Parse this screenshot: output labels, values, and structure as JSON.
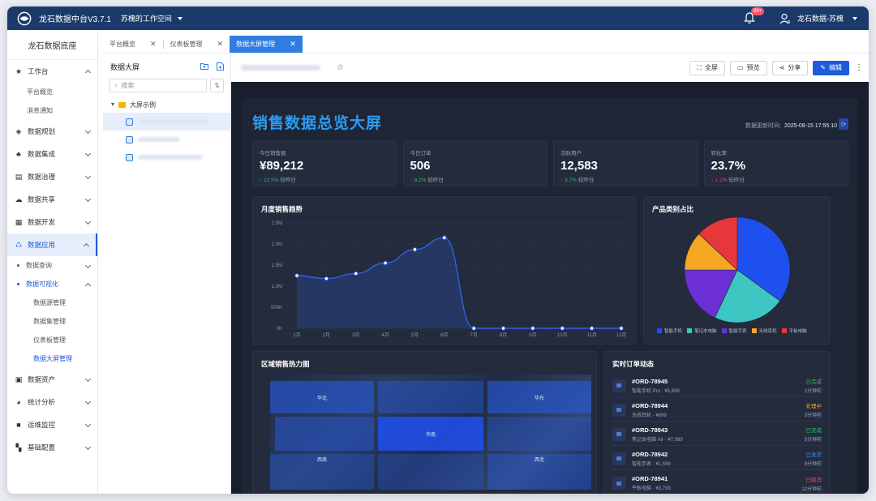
{
  "app": {
    "title": "龙石数据中台V3.7.1",
    "workspace": "苏槐的工作空间",
    "notif_count": "99+",
    "user": "龙石数据-苏槐"
  },
  "sidebar": {
    "brand": "龙石数据底座",
    "items": [
      {
        "label": "工作台",
        "icon": "star-icon",
        "open": true,
        "subs": [
          "平台概览",
          "消息通知"
        ]
      },
      {
        "label": "数据规划",
        "icon": "layers-icon"
      },
      {
        "label": "数据集成",
        "icon": "integration-icon"
      },
      {
        "label": "数据治理",
        "icon": "governance-icon"
      },
      {
        "label": "数据共享",
        "icon": "cloud-icon"
      },
      {
        "label": "数据开发",
        "icon": "dev-icon"
      },
      {
        "label": "数据应用",
        "icon": "app-icon",
        "active": true
      },
      {
        "label": "数据查询"
      },
      {
        "label": "数据可视化",
        "subs": [
          "数据源管理",
          "数据集管理",
          "仪表板管理",
          "数据大屏管理"
        ]
      },
      {
        "label": "数据资产",
        "icon": "asset-icon"
      },
      {
        "label": "统计分析",
        "icon": "pie-icon"
      },
      {
        "label": "运维监控",
        "icon": "video-icon"
      },
      {
        "label": "基础配置",
        "icon": "grid-icon"
      }
    ]
  },
  "tabs": [
    {
      "label": "平台概览"
    },
    {
      "label": "仪表板管理"
    },
    {
      "label": "数据大屏管理"
    }
  ],
  "tree": {
    "title": "数据大屏",
    "search_placeholder": "搜索",
    "folder": "大屏示例"
  },
  "toolbar": {
    "fullscreen": "全屏",
    "preview": "预览",
    "share": "分享",
    "edit": "编辑"
  },
  "dashboard": {
    "title": "销售数据总览大屏",
    "update_label": "数据更新时间:",
    "update_time": "2025-08-15 17:55:10",
    "kpis": [
      {
        "label": "今日销售额",
        "value": "¥89,212",
        "change": "12.5%",
        "dir": "up",
        "suffix": "较昨日"
      },
      {
        "label": "今日订单",
        "value": "506",
        "change": "8.2%",
        "dir": "up",
        "suffix": "较昨日"
      },
      {
        "label": "活跃用户",
        "value": "12,583",
        "change": "5.7%",
        "dir": "up",
        "suffix": "较昨日"
      },
      {
        "label": "转化率",
        "value": "23.7%",
        "change": "1.2%",
        "dir": "down",
        "suffix": "较昨日"
      }
    ],
    "trend_title": "月度销售趋势",
    "pie_title": "产品类别占比",
    "heat_title": "区域销售热力图",
    "orders_title": "实时订单动态",
    "heat_regions": [
      "华北",
      "华东",
      "华南",
      "西南",
      "西北"
    ],
    "orders": [
      {
        "id": "#ORD-78945",
        "desc": "智能手机 Pro · ¥5,699",
        "status": "已完成",
        "status_color": "#2fc25b",
        "time": "1分钟前"
      },
      {
        "id": "#ORD-78944",
        "desc": "无线耳机 · ¥899",
        "status": "处理中",
        "status_color": "#f5a623",
        "time": "3分钟前"
      },
      {
        "id": "#ORD-78943",
        "desc": "笔记本电脑 Air · ¥7,999",
        "status": "已完成",
        "status_color": "#2fc25b",
        "time": "5分钟前"
      },
      {
        "id": "#ORD-78942",
        "desc": "智能手表 · ¥1,599",
        "status": "已发货",
        "status_color": "#3a8ee6",
        "time": "8分钟前"
      },
      {
        "id": "#ORD-78941",
        "desc": "平板电脑 · ¥3,799",
        "status": "已取消",
        "status_color": "#f04864",
        "time": "12分钟前"
      }
    ]
  },
  "colors": {
    "accent": "#1d5bd8",
    "topbar": "#1b3a6b",
    "line": "#2f62e8"
  },
  "chart_data": [
    {
      "type": "line",
      "title": "月度销售趋势",
      "categories": [
        "1月",
        "2月",
        "3月",
        "4月",
        "5月",
        "6月",
        "7月",
        "8月",
        "9月",
        "10月",
        "11月",
        "12月"
      ],
      "values": [
        1250000,
        1180000,
        1300000,
        1550000,
        1870000,
        2150000,
        0,
        0,
        0,
        0,
        0,
        0
      ],
      "yticks": [
        "0K",
        "500K",
        "1.0M",
        "1.5M",
        "2.0M",
        "2.5M"
      ],
      "ylim": [
        0,
        2500000
      ],
      "grid": true
    },
    {
      "type": "pie",
      "title": "产品类别占比",
      "labels": [
        "智能手机",
        "笔记本电脑",
        "智能手表",
        "无线耳机",
        "平板电脑"
      ],
      "values": [
        35,
        22,
        18,
        12,
        13
      ],
      "colors": [
        "#1e50f0",
        "#3ec6c3",
        "#6d2fd6",
        "#f5a623",
        "#e8373a"
      ],
      "legend": "bottom"
    }
  ]
}
